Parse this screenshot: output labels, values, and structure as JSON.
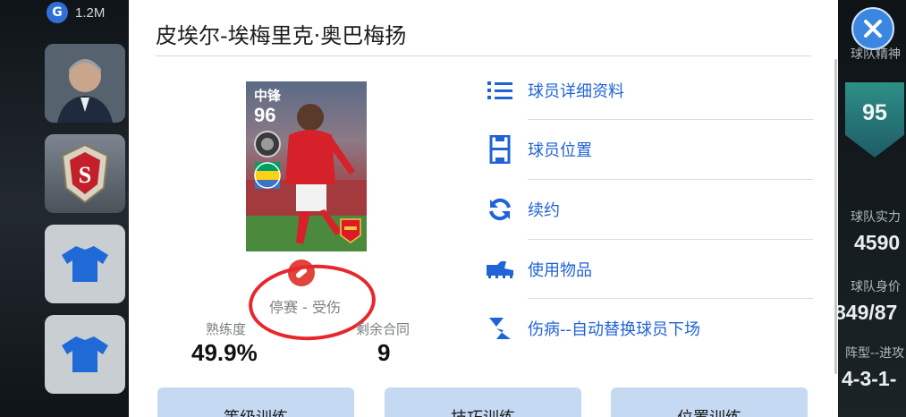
{
  "background": {
    "coins": {
      "icon": "G",
      "amount": "1.2M"
    },
    "right_panel": {
      "team_spirit_label": "球队精神",
      "team_spirit_value": "95",
      "team_strength_label": "球队实力",
      "team_strength_value": "4590",
      "team_height_label": "球队身价",
      "team_height_value": "849/87",
      "formation_label": "阵型--进攻",
      "formation_value": "4-3-1-"
    }
  },
  "player": {
    "name": "皮埃尔-埃梅里克·奥巴梅扬",
    "card_position": "中锋",
    "card_rating": "96",
    "status": "停赛 - 受伤",
    "proficiency_label": "熟练度",
    "proficiency_value": "49.9%",
    "contract_label": "剩余合同",
    "contract_value": "9"
  },
  "menu": [
    {
      "label": "球员详细资料",
      "icon": "list-icon"
    },
    {
      "label": "球员位置",
      "icon": "pitch-icon"
    },
    {
      "label": "续约",
      "icon": "refresh-icon"
    },
    {
      "label": "使用物品",
      "icon": "boot-icon"
    },
    {
      "label": "伤病--自动替换球员下场",
      "icon": "substitute-icon"
    }
  ],
  "bottom_buttons": [
    {
      "label": "等级训练"
    },
    {
      "label": "技巧训练"
    },
    {
      "label": "位置训练"
    }
  ],
  "colors": {
    "accent": "#1f63d6",
    "injury": "#e0443a",
    "annotation": "#e8262c",
    "button_bg": "#c6d9f3"
  }
}
